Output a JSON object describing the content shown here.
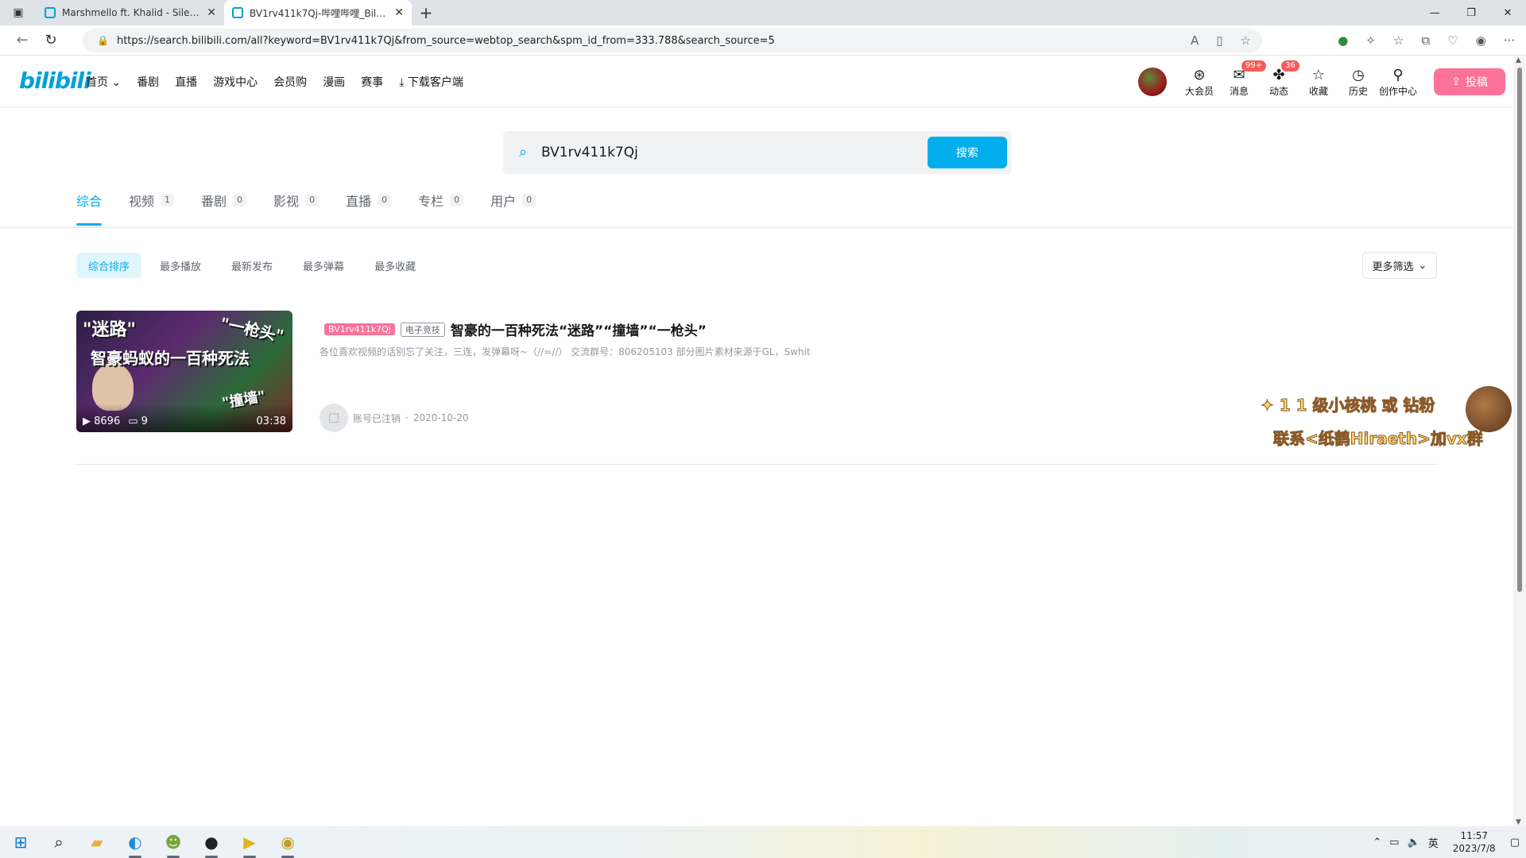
{
  "browser": {
    "tabs": [
      {
        "label": "Marshmello ft. Khalid - Silence (L"
      },
      {
        "label": "BV1rv411k7Qj-哔哩哔哩_Bilibili"
      }
    ],
    "url": "https://search.bilibili.com/all?keyword=BV1rv411k7Qj&from_source=webtop_search&spm_id_from=333.788&search_source=5"
  },
  "header": {
    "logo": "bilibili",
    "nav": [
      "首页",
      "番剧",
      "直播",
      "游戏中心",
      "会员购",
      "漫画",
      "赛事",
      "下载客户端"
    ],
    "icons": [
      {
        "label": "大会员",
        "icon": "vip-icon",
        "badge": ""
      },
      {
        "label": "消息",
        "icon": "message-icon",
        "badge": "99+"
      },
      {
        "label": "动态",
        "icon": "dynamic-icon",
        "badge": "36"
      },
      {
        "label": "收藏",
        "icon": "star-icon",
        "badge": ""
      },
      {
        "label": "历史",
        "icon": "clock-icon",
        "badge": ""
      },
      {
        "label": "创作中心",
        "icon": "bulb-icon",
        "badge": ""
      }
    ],
    "upload_label": "投稿"
  },
  "search": {
    "value": "BV1rv411k7Qj",
    "button": "搜索"
  },
  "cattabs": [
    {
      "label": "综合",
      "count": ""
    },
    {
      "label": "视频",
      "count": "1"
    },
    {
      "label": "番剧",
      "count": "0"
    },
    {
      "label": "影视",
      "count": "0"
    },
    {
      "label": "直播",
      "count": "0"
    },
    {
      "label": "专栏",
      "count": "0"
    },
    {
      "label": "用户",
      "count": "0"
    }
  ],
  "sort": [
    "综合排序",
    "最多播放",
    "最新发布",
    "最多弹幕",
    "最多收藏"
  ],
  "more_filter": "更多筛选",
  "result": {
    "thumb_texts": [
      "\"迷路\"",
      "\"一枪头\"",
      "智豪蚂蚁的一百种死法",
      "\"撞墙\""
    ],
    "plays": "8696",
    "danmaku": "9",
    "duration": "03:38",
    "tag_bv": "BV1rv411k7Qj",
    "tag_cat": "电子竞技",
    "title": "智豪的一百种死法“迷路”“撞墙”“一枪头”",
    "desc": "各位喜欢视频的话别忘了关注，三连，发弹幕呀~（//=//）   交流群号：806205103 部分图片素材来源于GL，Swhit",
    "author": "账号已注销",
    "date": "2020-10-20"
  },
  "sticker": {
    "line1": "1 1 级小核桃 或 钻粉",
    "line2": "联系<纸鹤Hiraeth>加vx群"
  },
  "taskbar": {
    "time": "11:57",
    "date": "2023/7/8",
    "ime": "英"
  }
}
